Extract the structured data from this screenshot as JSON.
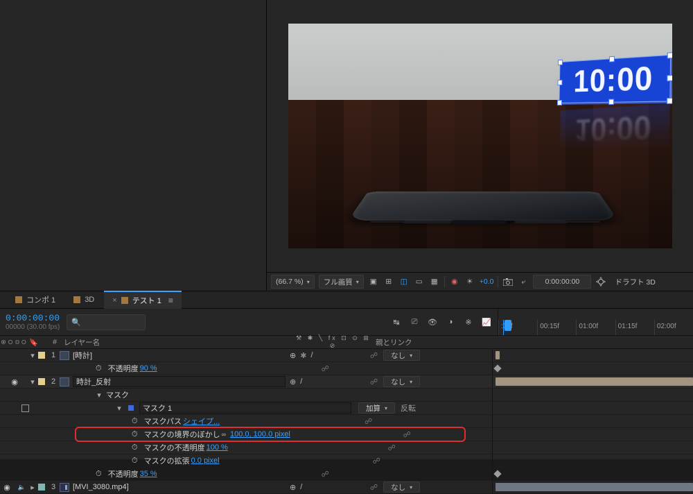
{
  "viewer": {
    "overlay_text": "10:00",
    "zoom": "(66.7 %)",
    "resolution": "フル画質",
    "exposure": "+0.0",
    "timecode": "0:00:00:00",
    "fastpreview": "ドラフト 3D"
  },
  "tabs": {
    "comp1": "コンポ 1",
    "three_d": "3D",
    "test1": "テスト 1"
  },
  "timeline": {
    "current_time": "0:00:00:00",
    "fps_line": "00000 (30.00 fps)",
    "search_placeholder": "",
    "columns": {
      "num": "#",
      "name": "レイヤー名",
      "switches": "⚒ ✱ ╲ fx ⊡ ⊙ ⊞ ⊘",
      "parent": "親とリンク"
    },
    "ruler": {
      "t0": ":00f",
      "t1": "00:15f",
      "t2": "01:00f",
      "t3": "01:15f",
      "t4": "02:00f"
    }
  },
  "layers": {
    "r1": {
      "num": "1",
      "name": "[時計]",
      "parent_label": "なし",
      "opacity_label": "不透明度",
      "opacity_val": "90 %"
    },
    "r2": {
      "num": "2",
      "name": "時計_反射",
      "parent_label": "なし",
      "mask_group": "マスク",
      "mask_name": "マスク 1",
      "mask_mode": "加算",
      "mask_invert": "反転",
      "mask_path_label": "マスクパス",
      "mask_path_val": "シェイプ...",
      "mask_feather_label": "マスクの境界のぼかし",
      "mask_feather_val": "100.0, 100.0 pixel",
      "mask_opacity_label": "マスクの不透明度",
      "mask_opacity_val": "100 %",
      "mask_expansion_label": "マスクの拡張",
      "mask_expansion_val": "0.0 pixel",
      "opacity_label": "不透明度",
      "opacity_val": "35 %"
    },
    "r3": {
      "num": "3",
      "name": "[MVI_3080.mp4]",
      "parent_label": "なし"
    }
  }
}
